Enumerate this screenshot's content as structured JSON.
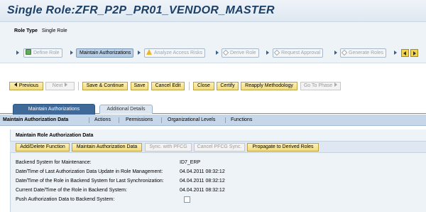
{
  "header": {
    "title": "Single Role:ZFR_P2P_PR01_VENDOR_MASTER"
  },
  "info": {
    "role_type_label": "Role Type",
    "role_type_value": "Single Role"
  },
  "roadmap": {
    "steps": [
      {
        "label": "Define Role",
        "icon": "check-icon",
        "state": "done"
      },
      {
        "label": "Maintain Authorizations",
        "icon": "none",
        "state": "active"
      },
      {
        "label": "Analyze Access Risks",
        "icon": "warning-icon",
        "state": "inactive"
      },
      {
        "label": "Derive Role",
        "icon": "diamond-icon",
        "state": "inactive"
      },
      {
        "label": "Request Approval",
        "icon": "diamond-icon",
        "state": "inactive"
      },
      {
        "label": "Generate Roles",
        "icon": "diamond-icon",
        "state": "inactive"
      }
    ]
  },
  "toolbar": {
    "previous": "Previous",
    "next": "Next",
    "save_continue": "Save & Continue",
    "save": "Save",
    "cancel_edit": "Cancel Edit",
    "close": "Close",
    "certify": "Certify",
    "reapply": "Reapply Methodology",
    "go_to_phase": "Go To Phase"
  },
  "tabs": {
    "active": "Maintain Authorizations",
    "inactive": "Additional Details"
  },
  "subnav": {
    "items": [
      "Maintain Authorization Data",
      "Actions",
      "Permissions",
      "Organizational Levels",
      "Functions"
    ]
  },
  "panel": {
    "title": "Maintain Role Authorization Data",
    "buttons": {
      "add_delete": "Add/Delete Function",
      "maintain_auth": "Maintain Authorization Data",
      "sync_pfcg": "Sync. with PFCG",
      "cancel_pfcg": "Cancel PFCG Sync.",
      "propagate": "Propagate to Derived Roles"
    },
    "fields": [
      {
        "label": "Backend System for Maintenance:",
        "value": "ID7_ERP"
      },
      {
        "label": "Date/Time of Last Authorization Data Update in Role Management:",
        "value": "04.04.2011 08:32:12"
      },
      {
        "label": "Date/Time of the Role in Backend System for Last Synchronization:",
        "value": "04.04.2011 08:32:12"
      },
      {
        "label": "Current Date/Time of the Role in Backend System:",
        "value": "04.04.2011 08:32:12"
      },
      {
        "label": "Push Authorization Data to Backend System:",
        "value": ""
      }
    ]
  }
}
